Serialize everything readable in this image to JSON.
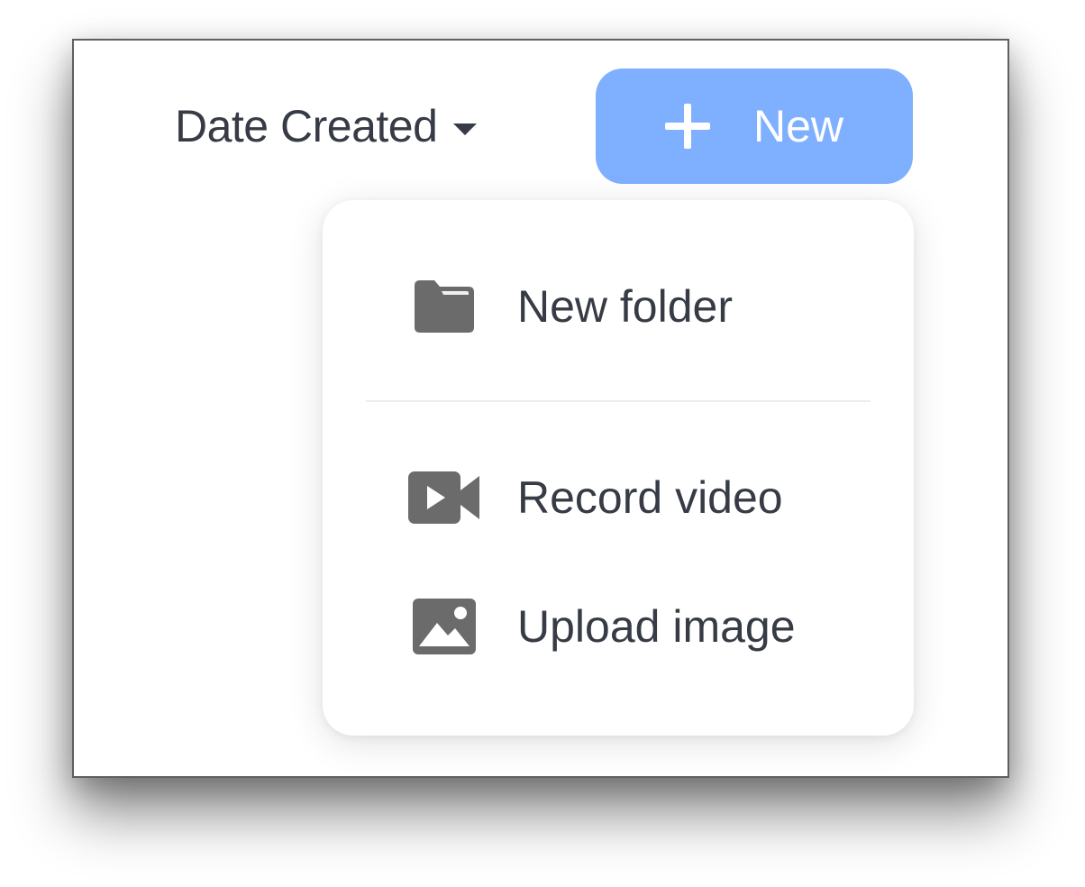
{
  "toolbar": {
    "sort_label": "Date Created",
    "new_label": "New",
    "accent_color": "#7fb0ff"
  },
  "menu": {
    "items": [
      {
        "label": "New folder",
        "icon": "folder-icon"
      },
      {
        "label": "Record video",
        "icon": "video-camera-icon"
      },
      {
        "label": "Upload image",
        "icon": "image-icon"
      }
    ]
  }
}
